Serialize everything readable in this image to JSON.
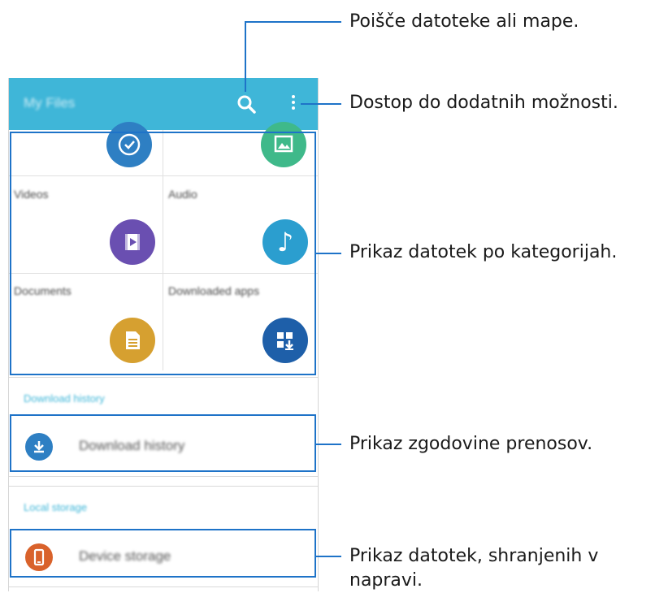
{
  "app": {
    "title": "My Files",
    "search_icon": "search-icon",
    "more_icon": "more-options-icon"
  },
  "categories": [
    {
      "label": "",
      "icon": "clock-icon",
      "color": "#2e7fc3"
    },
    {
      "label": "",
      "icon": "image-icon",
      "color": "#3fb98a"
    },
    {
      "label": "Videos",
      "icon": "video-icon",
      "color": "#6a4fb1"
    },
    {
      "label": "Audio",
      "icon": "music-note-icon",
      "color": "#2b9ecf"
    },
    {
      "label": "Documents",
      "icon": "document-icon",
      "color": "#d6a030"
    },
    {
      "label": "Downloaded apps",
      "icon": "downloaded-apps-icon",
      "color": "#1e5fa9"
    }
  ],
  "sections": {
    "download_history_header": "Download history",
    "download_history_item": "Download history",
    "local_storage_header": "Local storage",
    "device_storage_item": "Device storage"
  },
  "callouts": {
    "search": "Poišče datoteke ali mape.",
    "more": "Dostop do dodatnih možnosti.",
    "categories": "Prikaz datotek po kategorijah.",
    "history": "Prikaz zgodovine prenosov.",
    "storage": "Prikaz datotek, shranjenih v napravi."
  },
  "colors": {
    "appbar": "#3fb6d8",
    "accent_frame": "#1e73c8",
    "download_icon": "#2e7fc3",
    "device_icon": "#d9622b"
  }
}
